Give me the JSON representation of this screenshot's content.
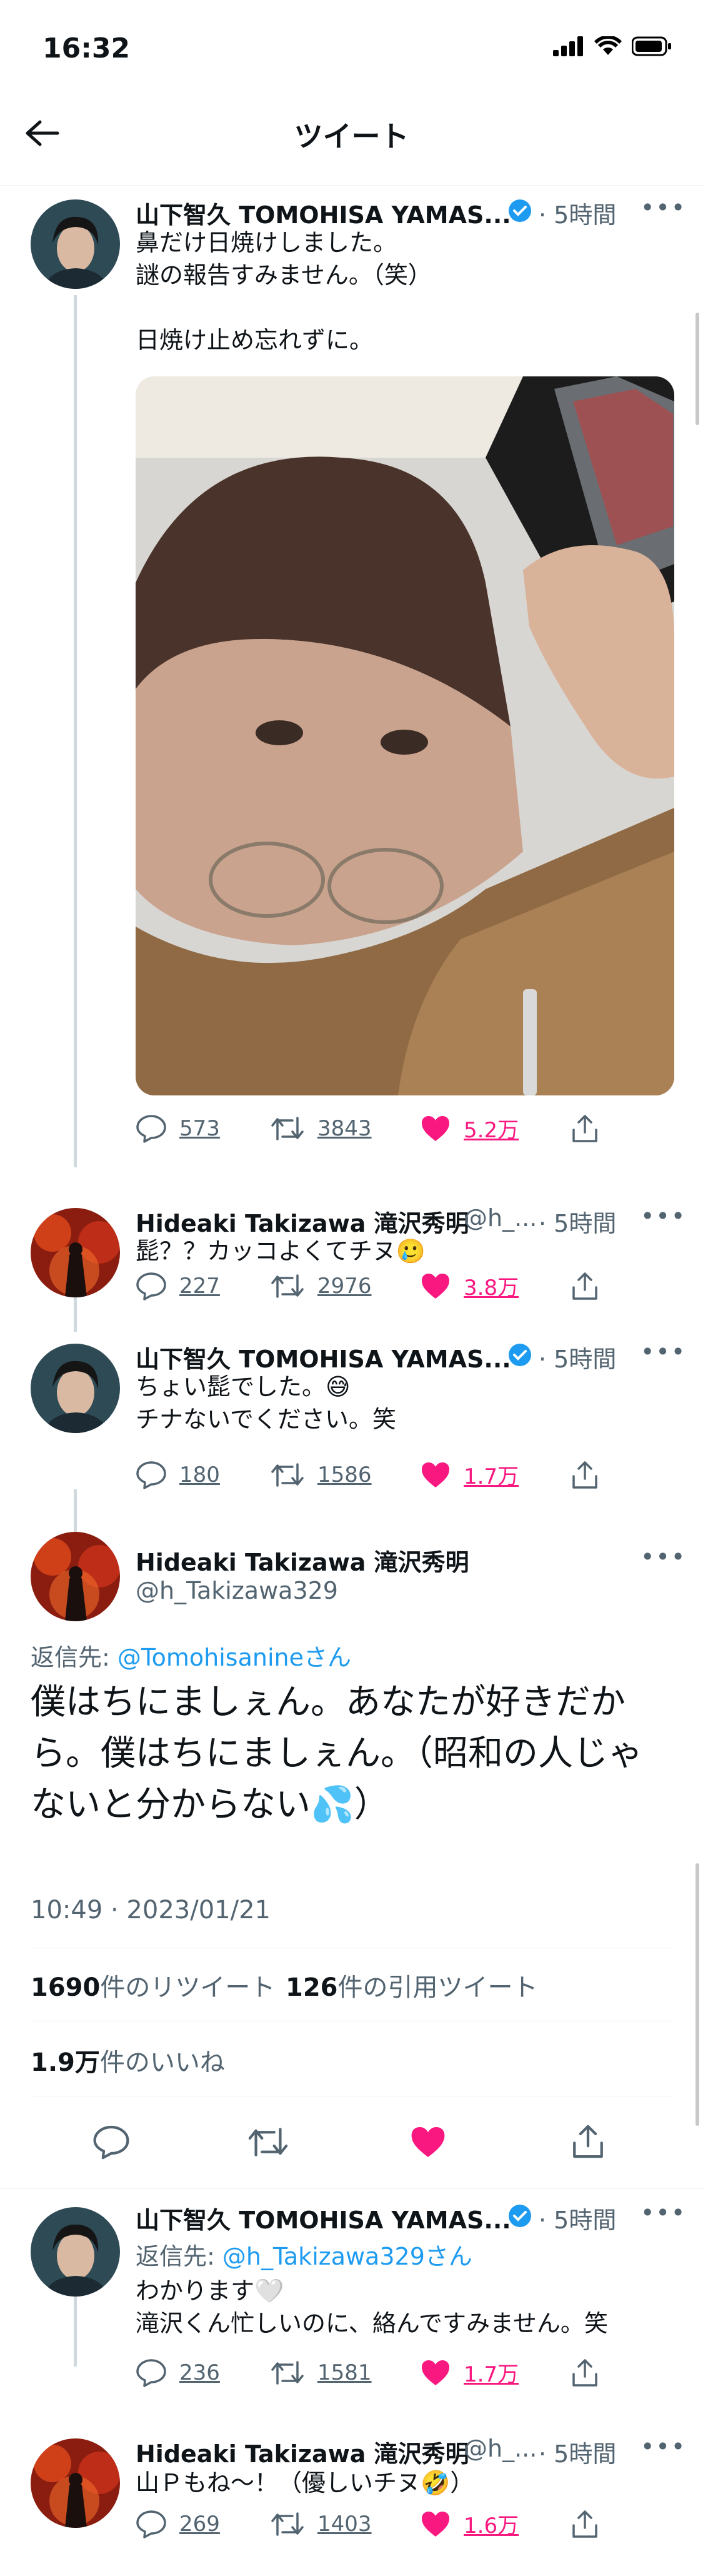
{
  "status_bar": {
    "time": "16:32"
  },
  "header": {
    "title": "ツイート"
  },
  "tweets": [
    {
      "name": "山下智久 TOMOHISA YAMAS...",
      "time": "· 5時間",
      "text": "鼻だけ日焼けしました。\n謎の報告すみません。（笑）\n\n日焼け止め忘れずに。",
      "replies": "573",
      "retweets": "3843",
      "likes": "5.2万"
    },
    {
      "name": "Hideaki Takizawa 滝沢秀明",
      "handle": "@h_...",
      "time": "· 5時間",
      "text": "髭？？カッコよくてチヌ🥲",
      "replies": "227",
      "retweets": "2976",
      "likes": "3.8万"
    },
    {
      "name": "山下智久 TOMOHISA YAMAS...",
      "time": "· 5時間",
      "text": "ちょい髭でした。😅\nチナないでください。笑",
      "replies": "180",
      "retweets": "1586",
      "likes": "1.7万"
    }
  ],
  "main_tweet": {
    "name": "Hideaki Takizawa 滝沢秀明",
    "handle": "@h_Takizawa329",
    "reply_prefix": "返信先: ",
    "reply_target": "@Tomohisanine",
    "reply_suffix": "さん",
    "text": "僕はちにましぇん。あなたが好きだから。僕はちにましぇん。（昭和の人じゃないと分からない💦）",
    "timestamp": "10:49 · 2023/01/21",
    "retweet_count": "1690",
    "retweet_label": "件のリツイート",
    "quote_count": "126",
    "quote_label": "件の引用ツイート",
    "like_count": "1.9万",
    "like_label": "件のいいね"
  },
  "replies": [
    {
      "name": "山下智久 TOMOHISA YAMAS...",
      "time": "· 5時間",
      "reply_prefix": "返信先: ",
      "reply_target": "@h_Takizawa329",
      "reply_suffix": "さん",
      "text": "わかります🤍\n滝沢くん忙しいのに、絡んですみません。笑",
      "replies": "236",
      "retweets": "1581",
      "likes": "1.7万"
    },
    {
      "name": "Hideaki Takizawa 滝沢秀明",
      "handle": "@h_...",
      "time": "· 5時間",
      "text": "山Ｐもね〜！（優しいチヌ🤣）",
      "replies": "269",
      "retweets": "1403",
      "likes": "1.6万"
    }
  ],
  "icons": [
    "signal-icon",
    "wifi-icon",
    "battery-icon",
    "back-arrow-icon",
    "verified-icon",
    "more-icon",
    "reply-icon",
    "retweet-icon",
    "like-icon",
    "share-icon"
  ],
  "colors": {
    "accent": "#1d9bf0",
    "like": "#f91880",
    "muted": "#536471",
    "verified": "#1d9bf0"
  }
}
